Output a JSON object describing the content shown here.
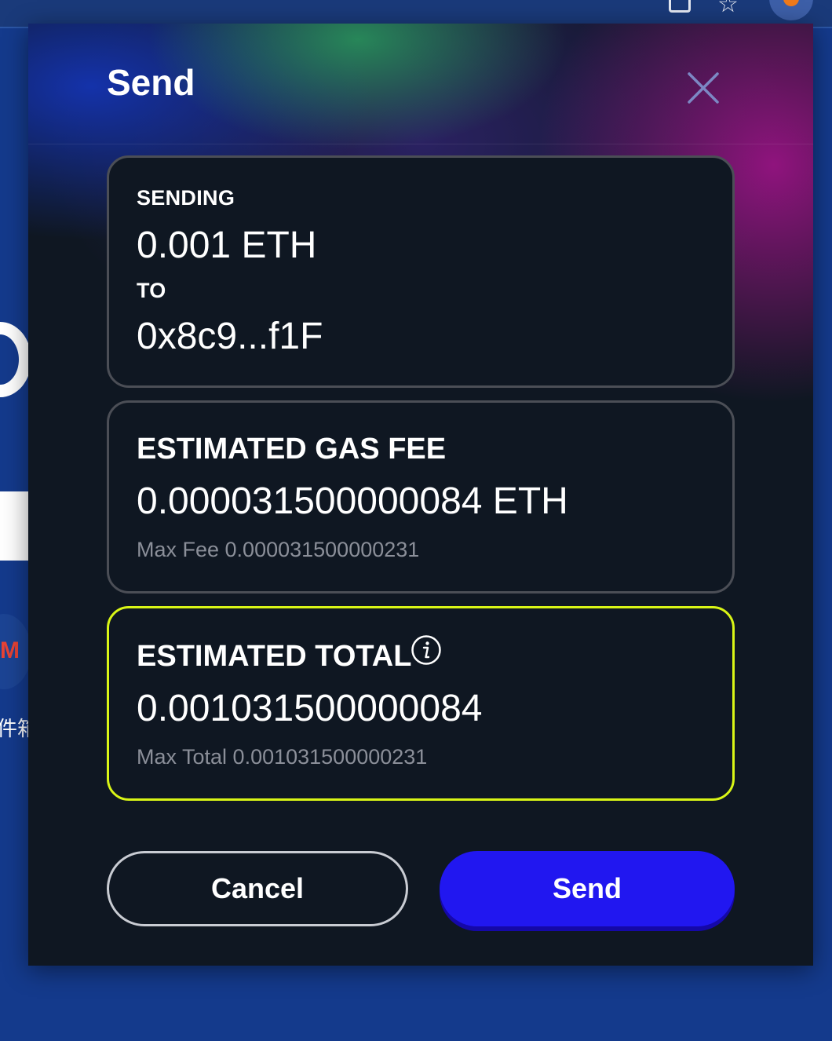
{
  "modal": {
    "title": "Send",
    "close_icon": "close-icon"
  },
  "sending_card": {
    "sending_label": "SENDING",
    "amount": "0.001 ETH",
    "to_label": "TO",
    "recipient": "0x8c9...f1F"
  },
  "gas_card": {
    "label": "ESTIMATED GAS FEE",
    "value": "0.000031500000084 ETH",
    "max_fee": "Max Fee 0.000031500000231"
  },
  "total_card": {
    "label": "ESTIMATED TOTAL",
    "info_icon": "info-icon",
    "value": "0.001031500000084",
    "max_total": "Max Total 0.001031500000231",
    "accent_color": "#d9f516"
  },
  "buttons": {
    "cancel": "Cancel",
    "send": "Send",
    "send_color": "#2117f0"
  },
  "background": {
    "partial_text": "件箱"
  }
}
